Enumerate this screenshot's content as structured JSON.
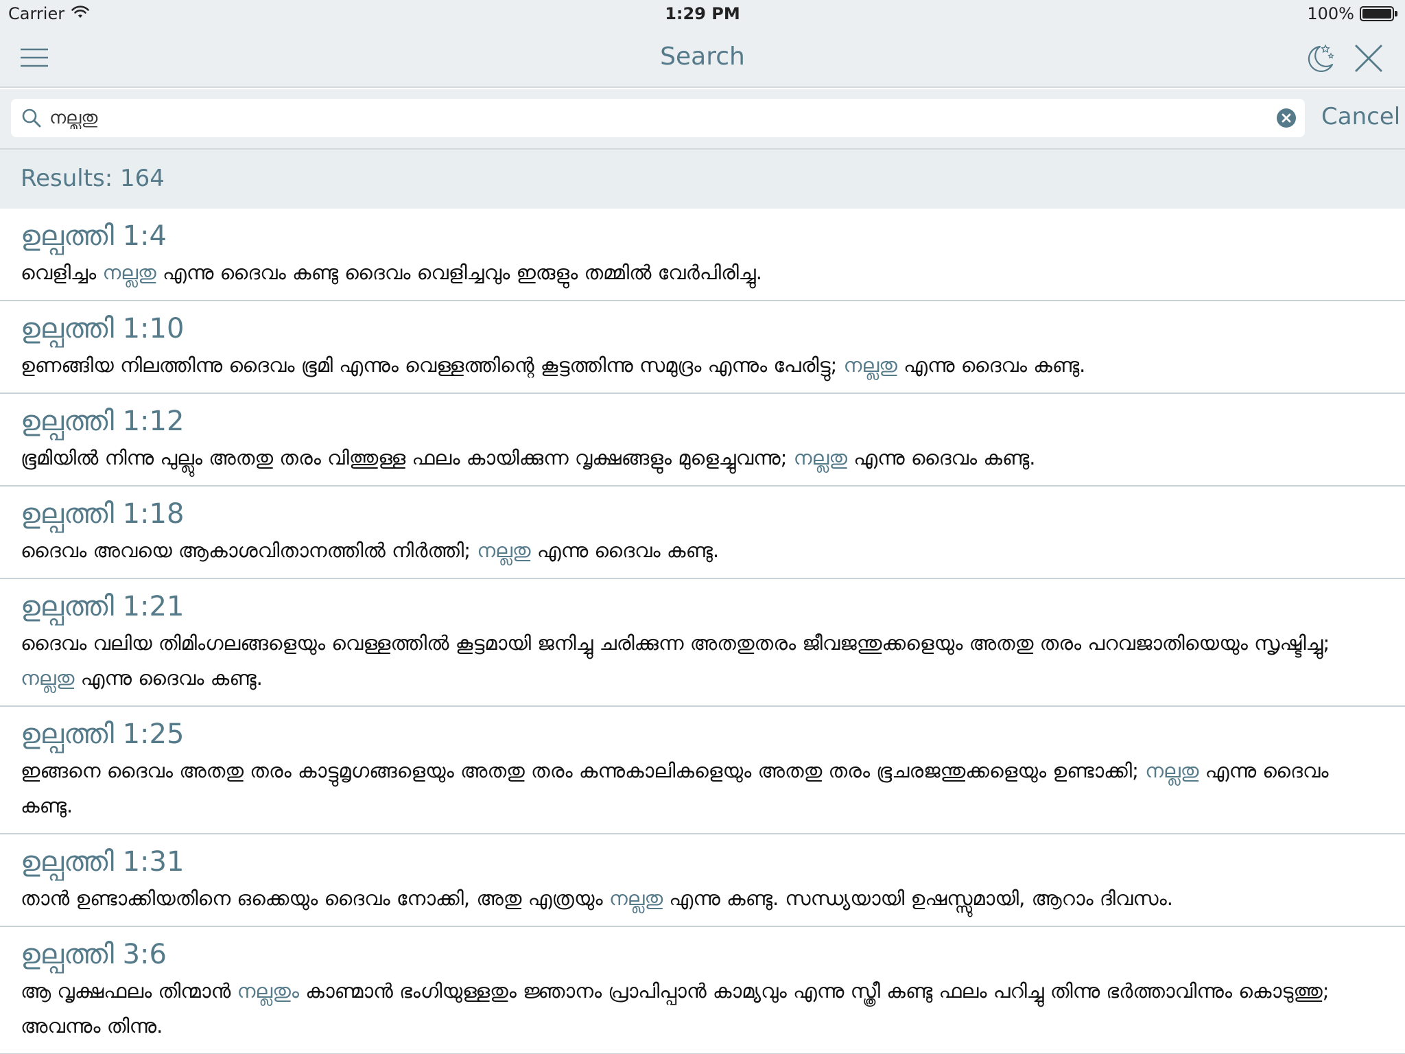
{
  "status_bar": {
    "carrier": "Carrier",
    "time": "1:29 PM",
    "battery": "100%",
    "battery_level": 1.0
  },
  "nav": {
    "title": "Search"
  },
  "search": {
    "query": "നല്ലതു",
    "cancel_label": "Cancel"
  },
  "results": {
    "count_label": "Results: 164",
    "items": [
      {
        "ref": "ഉല്പത്തി 1:4",
        "before": "വെളിച്ചം ",
        "match": "നല്ലതു",
        "after": " എന്നു ദൈവം കണ്ടു ദൈവം വെളിച്ചവും ഇരുളും തമ്മിൽ വേർപിരിച്ചു."
      },
      {
        "ref": "ഉല്പത്തി 1:10",
        "before": "ഉണങ്ങിയ നിലത്തിന്നു ദൈവം ഭൂമി എന്നും വെള്ളത്തിന്റെ കൂട്ടത്തിന്നു സമുദ്രം എന്നും പേരിട്ടു; ",
        "match": "നല്ലതു",
        "after": " എന്നു ദൈവം കണ്ടു."
      },
      {
        "ref": "ഉല്പത്തി 1:12",
        "before": "ഭൂമിയിൽ നിന്നു പുല്ലും അതതു തരം വിത്തുള്ള ഫലം കായിക്കുന്ന വൃക്ഷങ്ങളും മുളെച്ചുവന്നു; ",
        "match": "നല്ലതു",
        "after": " എന്നു ദൈവം കണ്ടു."
      },
      {
        "ref": "ഉല്പത്തി 1:18",
        "before": "ദൈവം അവയെ ആകാശവിതാനത്തിൽ നിർത്തി; ",
        "match": "നല്ലതു",
        "after": " എന്നു ദൈവം കണ്ടു."
      },
      {
        "ref": "ഉല്പത്തി 1:21",
        "before": "ദൈവം വലിയ തിമിംഗലങ്ങളെയും വെള്ളത്തിൽ കൂട്ടമായി ജനിച്ചു ചരിക്കുന്ന അതതുതരം ജീവജന്തുക്കളെയും അതതു തരം പറവജാതിയെയും സൃഷ്ടിച്ചു; ",
        "match": "നല്ലതു",
        "after": " എന്നു ദൈവം കണ്ടു."
      },
      {
        "ref": "ഉല്പത്തി 1:25",
        "before": "ഇങ്ങനെ ദൈവം അതതു തരം കാട്ടുമൃഗങ്ങളെയും അതതു തരം കന്നുകാലികളെയും അതതു തരം ഭൂചരജന്തുക്കളെയും ഉണ്ടാക്കി; ",
        "match": "നല്ലതു",
        "after": " എന്നു ദൈവം കണ്ടു."
      },
      {
        "ref": "ഉല്പത്തി 1:31",
        "before": "താൻ ഉണ്ടാക്കിയതിനെ ഒക്കെയും ദൈവം നോക്കി, അതു എത്രയും ",
        "match": "നല്ലതു",
        "after": " എന്നു കണ്ടു. സന്ധ്യയായി ഉഷസ്സുമായി, ആറാം ദിവസം."
      },
      {
        "ref": "ഉല്പത്തി 3:6",
        "before": "ആ വൃക്ഷഫലം തിന്മാൻ ",
        "match": "നല്ലതും",
        "after": " കാണ്മാൻ ഭംഗിയുള്ളതും ജ്ഞാനം പ്രാപിപ്പാൻ കാമ്യവും എന്നു സ്ത്രീ കണ്ടു ഫലം പറിച്ചു തിന്നു ഭർത്താവിന്നും കൊടുത്തു; അവന്നും തിന്നു."
      }
    ]
  },
  "icons": {
    "menu": "hamburger-menu-icon",
    "night_mode": "moon-stars-icon",
    "close": "close-icon",
    "search": "magnifier-icon",
    "clear": "clear-circle-icon",
    "wifi": "wifi-icon",
    "battery": "battery-icon"
  },
  "colors": {
    "accent": "#557a8a",
    "bar_bg": "#eceff1",
    "results_bg": "#e9eef1",
    "divider": "#c9d2d7"
  }
}
